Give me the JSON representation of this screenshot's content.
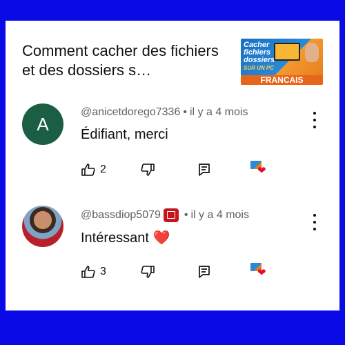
{
  "video": {
    "title": "Comment cacher des fichiers et des dossiers s…",
    "thumbnail": {
      "line1": "Cacher",
      "line2": "fichiers",
      "line3": "dossiers",
      "line4": "SUR UN PC",
      "bottom": "FRANCAIS"
    }
  },
  "comments": [
    {
      "author": "@anicetdorego7336",
      "separator": "•",
      "time": "il y a 4 mois",
      "avatar_letter": "A",
      "avatar_color": "#1b5e43",
      "text": "Édifiant, merci",
      "likes": "2",
      "has_member_badge": false,
      "creator_hearted": true
    },
    {
      "author": "@bassdiop5079",
      "separator": "•",
      "time": "il y a 4 mois",
      "avatar_letter": "",
      "text": "Intéressant ❤️",
      "likes": "3",
      "has_member_badge": true,
      "creator_hearted": true
    }
  ],
  "colors": {
    "border": "#0a0ae6",
    "heart": "#e0102a",
    "badge": "#c4161c"
  }
}
